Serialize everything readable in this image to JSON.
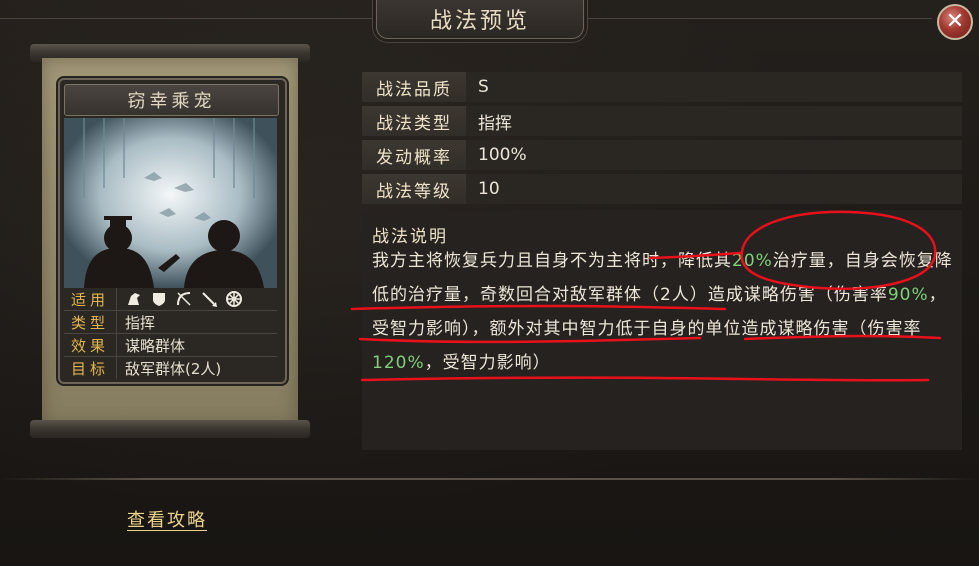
{
  "header": {
    "title": "战法预览",
    "close_icon": "close-icon"
  },
  "card": {
    "name": "窃幸乘宠",
    "stats": [
      {
        "key": "适用",
        "value": "",
        "icons": [
          "cavalry-icon",
          "shield-icon",
          "bow-icon",
          "spear-icon",
          "wheel-icon"
        ]
      },
      {
        "key": "类型",
        "value": "指挥"
      },
      {
        "key": "效果",
        "value": "谋略群体"
      },
      {
        "key": "目标",
        "value": "敌军群体(2人)"
      }
    ]
  },
  "info": {
    "rows": [
      {
        "label": "战法品质",
        "value": "S"
      },
      {
        "label": "战法类型",
        "value": "指挥"
      },
      {
        "label": "发动概率",
        "value": "100%"
      },
      {
        "label": "战法等级",
        "value": "10"
      }
    ],
    "desc_label": "战法说明",
    "desc_segments": [
      {
        "text": "我方主将恢复兵力且自身不为主将时，降低其",
        "highlight": false
      },
      {
        "text": "20%",
        "highlight": true
      },
      {
        "text": "治疗量，自身会恢复降低的治疗量，奇数回合对敌军群体（2人）造成谋略伤害（伤害率",
        "highlight": false
      },
      {
        "text": "90%",
        "highlight": true
      },
      {
        "text": "，受智力影响），额外对其中智力低于自身的单位造成谋略伤害（伤害率",
        "highlight": false
      },
      {
        "text": "120%",
        "highlight": true
      },
      {
        "text": "，受智力影响）",
        "highlight": false
      }
    ]
  },
  "footer": {
    "guide_link": "查看攻略"
  },
  "colors": {
    "accent_gold": "#e3b54f",
    "highlight_green": "#7fd17a",
    "annotation_red": "#e8101a"
  }
}
